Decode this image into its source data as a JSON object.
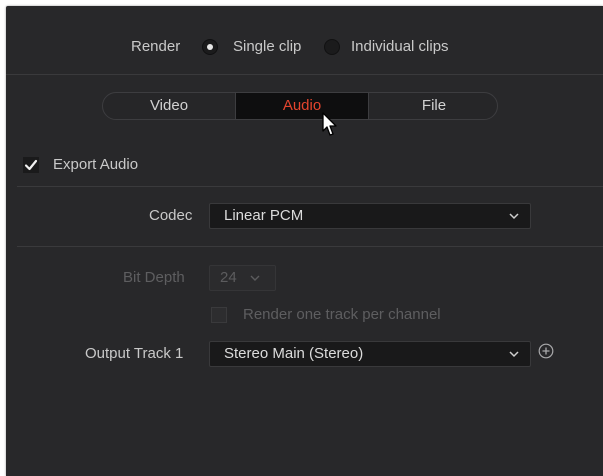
{
  "render": {
    "label": "Render",
    "options": [
      {
        "label": "Single clip",
        "selected": true
      },
      {
        "label": "Individual clips",
        "selected": false
      }
    ]
  },
  "tabs": [
    {
      "label": "Video",
      "active": false
    },
    {
      "label": "Audio",
      "active": true
    },
    {
      "label": "File",
      "active": false
    }
  ],
  "export_audio": {
    "label": "Export Audio",
    "checked": true
  },
  "codec": {
    "label": "Codec",
    "value": "Linear PCM"
  },
  "bit_depth": {
    "label": "Bit Depth",
    "value": "24",
    "enabled": false
  },
  "render_per_channel": {
    "label": "Render one track per channel",
    "checked": false,
    "enabled": false
  },
  "output_track": {
    "label": "Output Track 1",
    "value": "Stereo Main (Stereo)"
  },
  "colors": {
    "panel_bg": "#28282a",
    "active_tab_text": "#e5452e",
    "text": "#c9c9c9",
    "disabled_text": "#5e5e60"
  },
  "icons": {
    "dropdown": "chevron-down-icon",
    "add_track": "plus-circle-icon",
    "cursor": "mouse-pointer-icon",
    "check": "checkmark-icon"
  }
}
